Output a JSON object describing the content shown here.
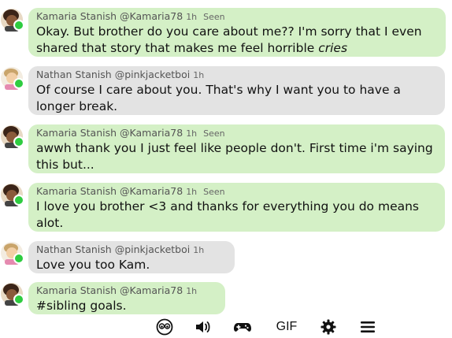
{
  "messages": [
    {
      "user": "Kamaria Stanish",
      "handle": "@Kamaria78",
      "time": "1h",
      "seen": "Seen",
      "sender": "me",
      "text": "Okay. But brother do you care about me?? I'm sorry that I even shared that story that makes me feel horrible ",
      "emphasis": "cries"
    },
    {
      "user": "Nathan Stanish",
      "handle": "@pinkjacketboi",
      "time": "1h",
      "seen": "",
      "sender": "them",
      "text": "Of course I care about you. That's why I want you to have a longer break.",
      "emphasis": ""
    },
    {
      "user": "Kamaria Stanish",
      "handle": "@Kamaria78",
      "time": "1h",
      "seen": "Seen",
      "sender": "me",
      "text": "awwh thank you I just feel like people don't. First time i'm saying this but...",
      "emphasis": ""
    },
    {
      "user": "Kamaria Stanish",
      "handle": "@Kamaria78",
      "time": "1h",
      "seen": "Seen",
      "sender": "me",
      "text": "I love you brother <3 and thanks for everything you do means alot.",
      "emphasis": ""
    },
    {
      "user": "Nathan Stanish",
      "handle": "@pinkjacketboi",
      "time": "1h",
      "seen": "",
      "sender": "them",
      "text": "Love you too Kam.",
      "emphasis": ""
    },
    {
      "user": "Kamaria Stanish",
      "handle": "@Kamaria78",
      "time": "1h",
      "seen": "",
      "sender": "me",
      "text": "#sibling goals.",
      "emphasis": ""
    }
  ],
  "toolbar": {
    "gif_label": "GIF",
    "icons": [
      "emoji-icon",
      "sound-icon",
      "gamepad-icon",
      "gif",
      "gear-icon",
      "menu-icon"
    ]
  },
  "colors": {
    "my_bubble": "#d4f0c6",
    "their_bubble": "#e3e3e3",
    "online": "#2ecc40"
  }
}
